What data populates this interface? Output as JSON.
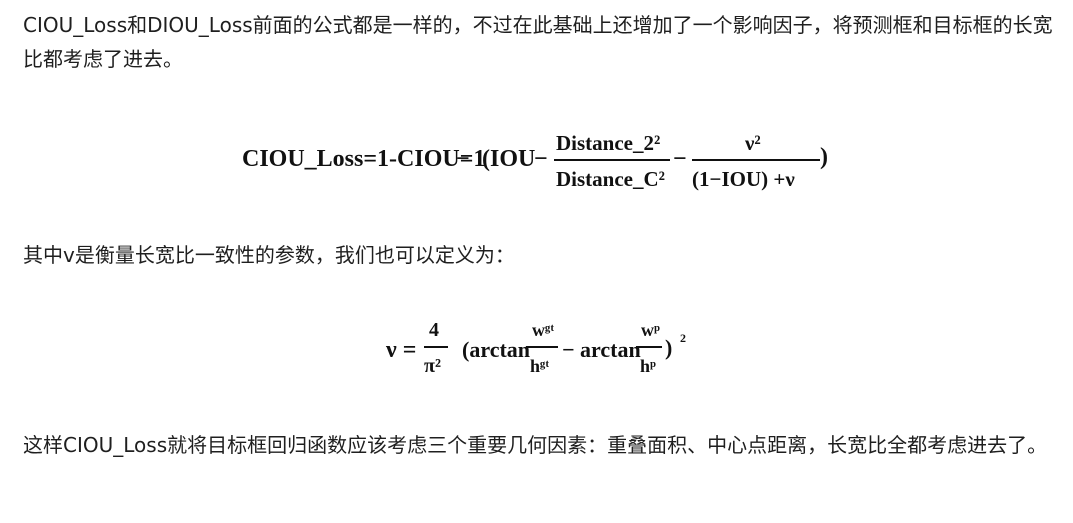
{
  "paragraphs": {
    "intro": "CIOU_Loss和DIOU_Loss前面的公式都是一样的，不过在此基础上还增加了一个影响因子，将预测框和目标框的长宽比都考虑了进去。",
    "v_definition": "其中v是衡量长宽比一致性的参数，我们也可以定义为：",
    "conclusion": "这样CIOU_Loss就将目标框回归函数应该考虑三个重要几何因素：重叠面积、中心点距离，长宽比全都考虑进去了。"
  },
  "formula_ciou": {
    "lhs": "CIOU_Loss=1-CIOU=1",
    "minus": "−",
    "open": "(IOU",
    "frac1_num": "Distance_2²",
    "frac1_den": "Distance_C²",
    "frac2_num": "ν²",
    "frac2_den": "(1−IOU) +ν",
    "close": ")"
  },
  "formula_v": {
    "lhs": "ν =",
    "frac_num": "4",
    "frac_den": "π²",
    "arctan1": "(arctan",
    "w_gt": "wᵍᵗ",
    "h_gt": "hᵍᵗ",
    "minus": "−",
    "arctan2": "arctan",
    "w_p": "wᵖ",
    "h_p": "hᵖ",
    "close": ")",
    "power": "2"
  }
}
